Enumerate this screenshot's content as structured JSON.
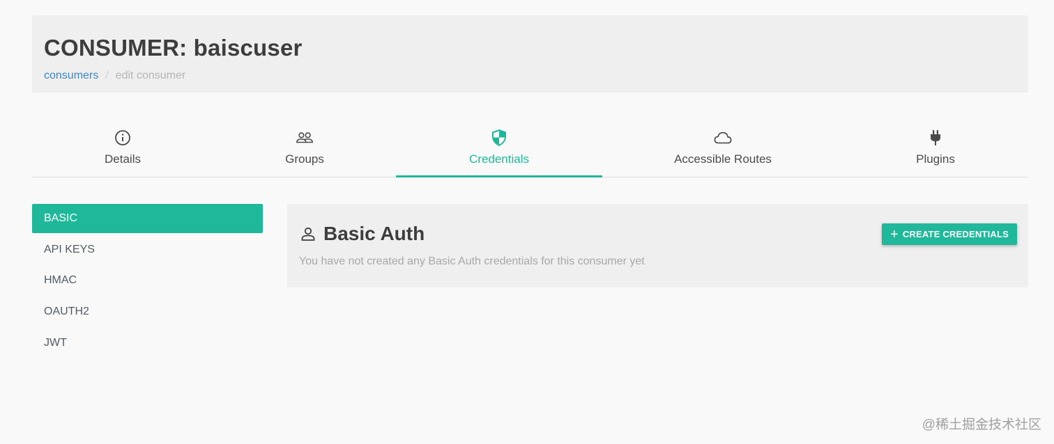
{
  "header": {
    "title": "CONSUMER: baiscuser",
    "breadcrumb": {
      "link": "consumers",
      "separator": "/",
      "current": "edit consumer"
    }
  },
  "tabs": [
    {
      "label": "Details",
      "icon": "info-circle-icon"
    },
    {
      "label": "Groups",
      "icon": "users-icon"
    },
    {
      "label": "Credentials",
      "icon": "shield-icon",
      "active": true
    },
    {
      "label": "Accessible Routes",
      "icon": "cloud-icon"
    },
    {
      "label": "Plugins",
      "icon": "plug-icon"
    }
  ],
  "credential_types": [
    {
      "label": "BASIC",
      "active": true
    },
    {
      "label": "API KEYS"
    },
    {
      "label": "HMAC"
    },
    {
      "label": "OAUTH2"
    },
    {
      "label": "JWT"
    }
  ],
  "panel": {
    "title": "Basic Auth",
    "icon": "user-icon",
    "message": "You have not created any Basic Auth credentials for this consumer yet",
    "create_button": "CREATE CREDENTIALS"
  },
  "watermark": "@稀土掘金技术社区",
  "colors": {
    "accent": "#1fb89a",
    "link": "#3a87c8"
  }
}
